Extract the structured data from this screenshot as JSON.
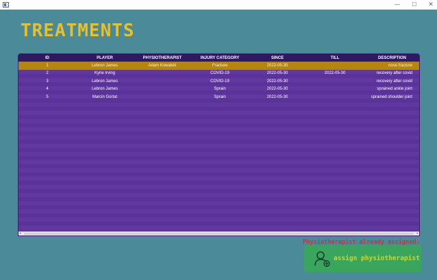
{
  "window": {
    "minimize_glyph": "—",
    "maximize_glyph": "☐",
    "close_glyph": "✕"
  },
  "page_title": "TREATMENTS",
  "table": {
    "columns": [
      "ID",
      "PLAYER",
      "PHYSIOTHERAPIST",
      "INJURY CATEGORY",
      "SINCE",
      "TILL",
      "DESCRIPTION"
    ],
    "rows": [
      [
        "1",
        "Lebron James",
        "Adam Kowalski",
        "Fracture",
        "2022-05-30",
        "",
        "nose fracture"
      ],
      [
        "2",
        "Kyrie Irving",
        "",
        "COVID-19",
        "2022-05-30",
        "2022-05-30",
        "recovery after covid"
      ],
      [
        "3",
        "Lebron James",
        "",
        "COVID-19",
        "2022-05-30",
        "",
        "recovery after covid"
      ],
      [
        "4",
        "Lebron James",
        "",
        "Sprain",
        "2022-05-30",
        "",
        "sprained ankle joint"
      ],
      [
        "5",
        "Marcin Gortat",
        "",
        "Sprain",
        "2022-05-30",
        "",
        "sprained shoulder joint"
      ]
    ],
    "selected_row": 0
  },
  "status_message": "Physiotherapist already assigned.",
  "assign_button": {
    "label": "assign physiotherapist",
    "icon": "user-icon"
  },
  "colors": {
    "background": "#4b8a99",
    "title": "#e6c12d",
    "table_body": "#5b329a",
    "table_header": "#2e1a63",
    "selected_row": "#b4850f",
    "message": "#e22b2b",
    "button": "#3aa55c",
    "button_text": "#d4d41a"
  }
}
